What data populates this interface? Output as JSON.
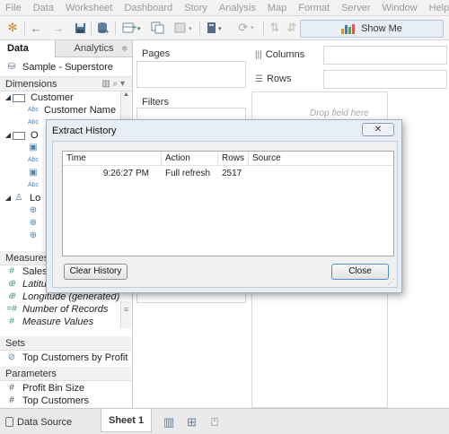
{
  "menu": [
    "File",
    "Data",
    "Worksheet",
    "Dashboard",
    "Story",
    "Analysis",
    "Map",
    "Format",
    "Server",
    "Window",
    "Help"
  ],
  "toolbar": {
    "show_me": "Show Me"
  },
  "left_pane": {
    "tabs": [
      "Data",
      "Analytics"
    ],
    "datasource": "Sample - Superstore",
    "dimensions_label": "Dimensions",
    "dimensions": [
      {
        "icon": "folder",
        "label": "Customer"
      },
      {
        "icon": "abc",
        "label": "Customer Name"
      },
      {
        "icon": "abc",
        "label": ""
      },
      {
        "icon": "folder",
        "label": "O"
      },
      {
        "icon": "date",
        "label": ""
      },
      {
        "icon": "abc",
        "label": ""
      },
      {
        "icon": "date",
        "label": ""
      },
      {
        "icon": "abc",
        "label": ""
      },
      {
        "icon": "hierarchy",
        "label": "Lo"
      },
      {
        "icon": "globe",
        "label": ""
      },
      {
        "icon": "globe",
        "label": ""
      },
      {
        "icon": "globe",
        "label": ""
      }
    ],
    "measures_label": "Measures",
    "measures": [
      {
        "icon": "#",
        "label": "Sales"
      },
      {
        "icon": "globe",
        "label": "Latitu",
        "italic": true
      },
      {
        "icon": "globe",
        "label": "Longitude (generated)",
        "italic": true
      },
      {
        "icon": "#",
        "label": "Number of Records",
        "italic": true
      },
      {
        "icon": "#",
        "label": "Measure Values",
        "italic": true
      }
    ],
    "sets_label": "Sets",
    "sets": [
      {
        "label": "Top Customers by Profit"
      }
    ],
    "parameters_label": "Parameters",
    "parameters": [
      {
        "label": "Profit Bin Size"
      },
      {
        "label": "Top Customers"
      }
    ]
  },
  "shelves": {
    "pages": "Pages",
    "filters": "Filters",
    "columns": "Columns",
    "rows": "Rows",
    "drop_hint": "Drop field here"
  },
  "dialog": {
    "title": "Extract History",
    "columns": [
      "Time",
      "Action",
      "Rows",
      "Source"
    ],
    "rows": [
      {
        "time": "9:26:27 PM",
        "action": "Full refresh",
        "rows": "2517",
        "source": ""
      }
    ],
    "clear_button": "Clear History",
    "close_button": "Close"
  },
  "bottom": {
    "data_source": "Data Source",
    "sheet": "Sheet 1"
  }
}
